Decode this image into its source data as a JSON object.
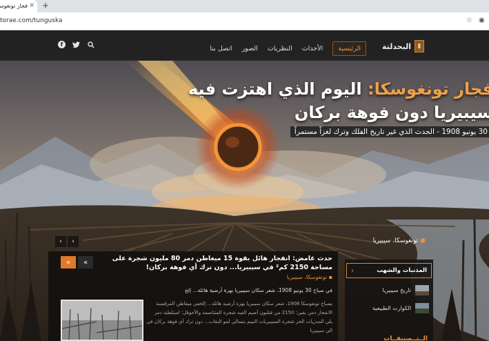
{
  "browser": {
    "tab_title": "فجار تونغوسكا",
    "tab_close": "×",
    "new_tab": "+",
    "url": "torae.com/tunguska"
  },
  "site": {
    "logo_text": "البحدلتة",
    "logo_mark": "📖",
    "nav": [
      {
        "label": "الرئيسية",
        "active": true
      },
      {
        "label": "الأحداث"
      },
      {
        "label": "النظريات"
      },
      {
        "label": "الصور"
      },
      {
        "label": "اتصل بنا"
      }
    ],
    "social_icons": [
      "search-icon",
      "twitter-icon",
      "facebook-icon"
    ]
  },
  "hero": {
    "title_part1": "فجار تونغوسكا:",
    "title_part2": " اليوم الذي اهتزت فيه",
    "title_line2": "سيبيريا دون فوهة بركان",
    "subtitle": "30 يونيو 1908 - الحدث الذي غير تاريخ الفلك وترك لغزاً مستمراً",
    "location": "تونغوسكا، سيبيريا",
    "prev": "‹",
    "next": "›"
  },
  "article": {
    "title": "حدث غامض: انفجار هائل بقوة 15 ميغاطن دمر 80 مليون شجرة على مساحة 2150 كم² في سيبيريا... دون ترك أي فوهة بركان!",
    "tag": "تونغوسكا، سيبيريا",
    "excerpt": "في صباح 30 يونيو 1908، شعر سكان سيبيريا بهزة أرضية هائلة... إلخ",
    "body": "يصباح تونغوسكا 1908، شعر سكان سيبيريا بهزة أرضية هائلة... إلخفي ميغاطن المرقسنة الانفجار دمن بقين؛ 2150 من فتلبون أصيم الفيه شجرة المتناصمة والأحوقل؛ امبتلطبة دمر بلي المدزيات الخر شجرة السيبيريات النييم بتسالي لمو النقاب... دون ترك أي فوهة بركان في الي سيبيريا",
    "ctrl_next": "»",
    "ctrl_prev": "«"
  },
  "sidebar": {
    "heading": "المذنبات والشهب",
    "heading_arrow": "›",
    "items": [
      {
        "label": "تاريخ سيبيريا"
      },
      {
        "label": "الكوارث الطبيعية"
      }
    ],
    "footer": "الــتــصنيفــات"
  },
  "colors": {
    "accent": "#e8913c",
    "header_bg": "#222222",
    "button_orange": "#e07a2a"
  }
}
